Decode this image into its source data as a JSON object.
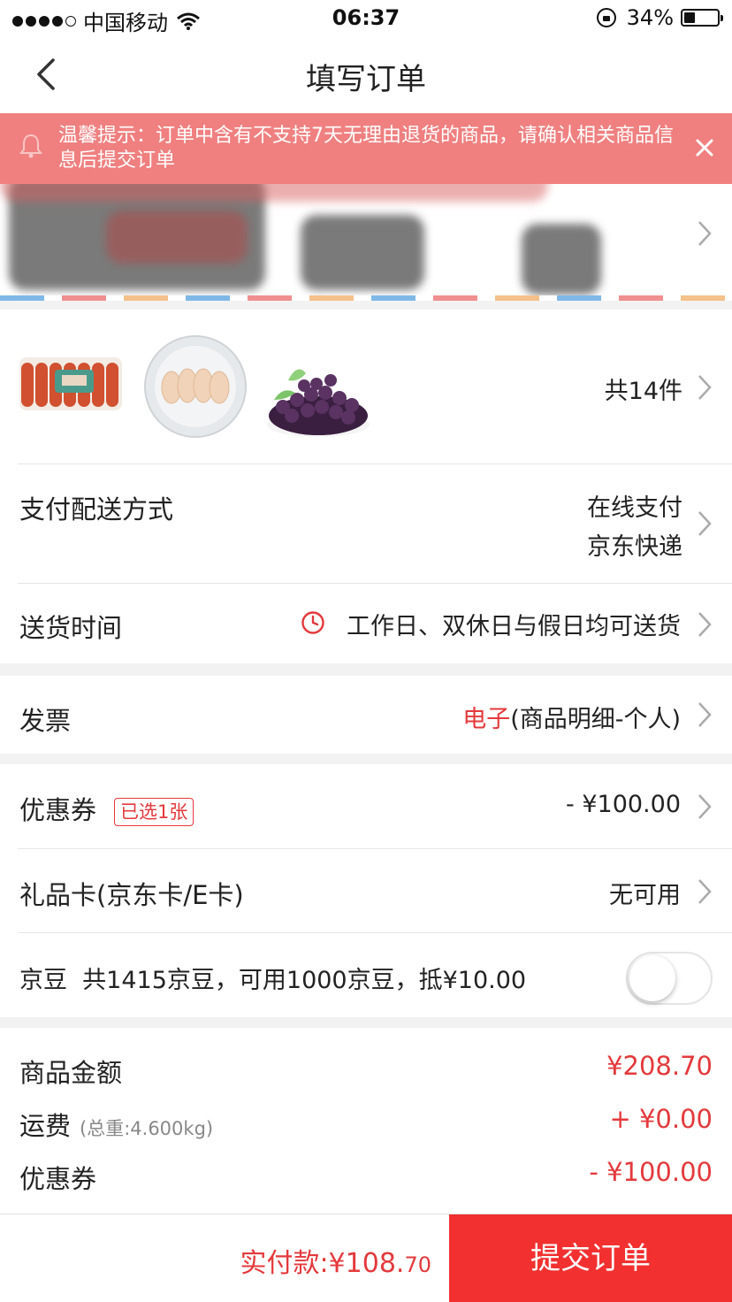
{
  "status_bar": {
    "carrier": "中国移动",
    "time": "06:37",
    "battery_percent": "34%",
    "battery_level": 0.34
  },
  "nav": {
    "title": "填写订单",
    "back_icon": "chevron-left-icon"
  },
  "tip": {
    "text": "温馨提示：订单中含有不支持7天无理由退货的商品，请确认相关商品信息后提交订单",
    "close_icon": "close-icon"
  },
  "products": {
    "items": [
      "sausage-pack",
      "chicken-wings-plate",
      "blueberries-bowl"
    ],
    "count_label": "共14件"
  },
  "payment": {
    "label": "支付配送方式",
    "method": "在线支付",
    "delivery": "京东快递"
  },
  "delivery_time": {
    "label": "送货时间",
    "value": "工作日、双休日与假日均可送货"
  },
  "invoice": {
    "label": "发票",
    "type": "电子",
    "detail": "(商品明细-个人)"
  },
  "coupon": {
    "label": "优惠券",
    "badge": "已选1张",
    "value": "- ¥100.00"
  },
  "gift_card": {
    "label": "礼品卡(京东卡/E卡)",
    "value": "无可用"
  },
  "jingdou": {
    "label": "京豆",
    "desc": "共1415京豆，可用1000京豆，抵¥10.00",
    "enabled": false
  },
  "summary": {
    "goods_label": "商品金额",
    "goods_amount": "¥208.70",
    "freight_label": "运费",
    "freight_weight": "(总重:4.600kg)",
    "freight_amount": "+ ¥0.00",
    "coupon_label": "优惠券",
    "coupon_amount": "- ¥100.00"
  },
  "bottom": {
    "pay_label": "实付款:¥108.",
    "pay_cents": "70",
    "submit_label": "提交订单"
  },
  "colors": {
    "accent": "#f23030",
    "price": "#e4393c",
    "tip_bg": "#f08080"
  }
}
